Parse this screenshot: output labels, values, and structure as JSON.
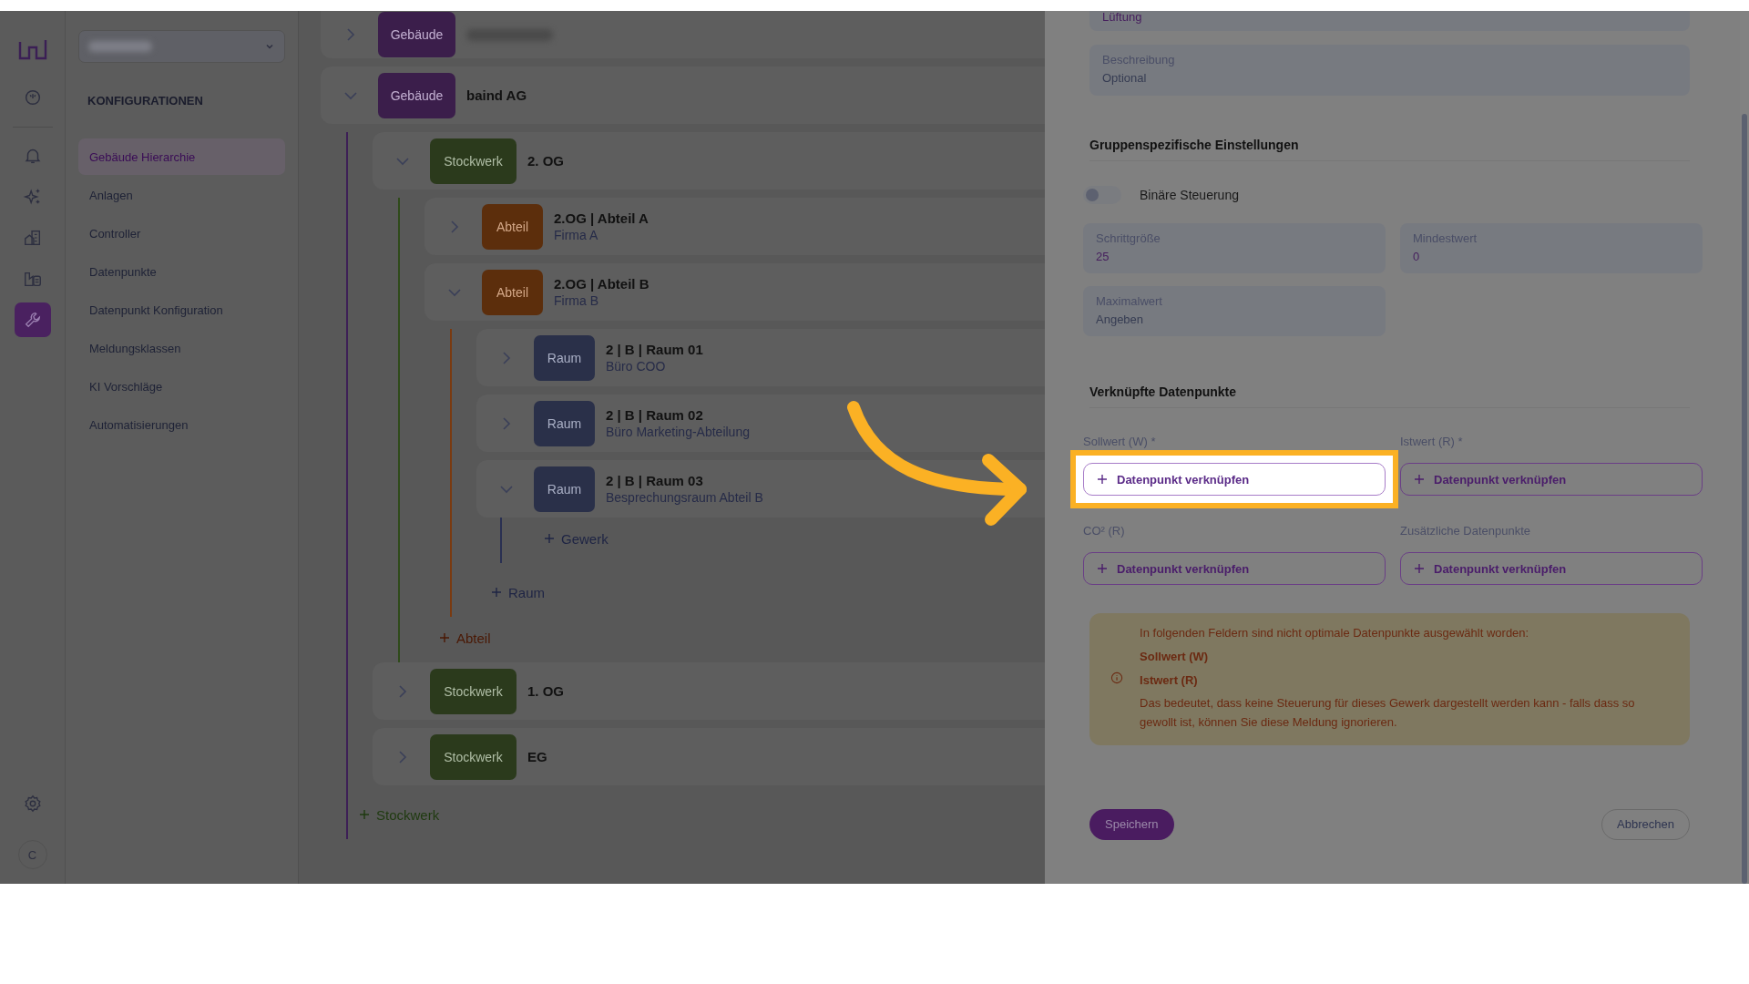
{
  "rail": {
    "items": [
      {
        "kind": "gauge",
        "selected": false
      },
      {
        "kind": "bell",
        "selected": false
      },
      {
        "kind": "sparkle",
        "selected": false
      },
      {
        "kind": "buildings",
        "selected": false
      },
      {
        "kind": "factory",
        "selected": false
      },
      {
        "kind": "wrench",
        "selected": true
      }
    ],
    "footer": [
      {
        "kind": "gear",
        "selected": false
      }
    ],
    "avatar": "C"
  },
  "nav": {
    "title": "KONFIGURATIONEN",
    "items": [
      {
        "label": "Gebäude Hierarchie",
        "selected": true
      },
      {
        "label": "Anlagen",
        "selected": false
      },
      {
        "label": "Controller",
        "selected": false
      },
      {
        "label": "Datenpunkte",
        "selected": false
      },
      {
        "label": "Datenpunkt Konfiguration",
        "selected": false
      },
      {
        "label": "Meldungsklassen",
        "selected": false
      },
      {
        "label": "KI Vorschläge",
        "selected": false
      },
      {
        "label": "Automatisierungen",
        "selected": false
      }
    ]
  },
  "tree": {
    "nodes": [
      {
        "kind": "building",
        "badge": "Gebäude",
        "expanded": false
      },
      {
        "kind": "building",
        "badge": "Gebäude",
        "title": "baind AG",
        "expanded": true,
        "add": {
          "kind": "floor",
          "label": "Stockwerk"
        },
        "children": [
          {
            "kind": "floor",
            "badge": "Stockwerk",
            "title": "2. OG",
            "expanded": true,
            "add": {
              "kind": "section",
              "label": "Abteil"
            },
            "children": [
              {
                "kind": "section",
                "badge": "Abteil",
                "title": "2.OG | Abteil A",
                "subtitle": "Firma A",
                "expanded": false
              },
              {
                "kind": "section",
                "badge": "Abteil",
                "title": "2.OG | Abteil B",
                "subtitle": "Firma B",
                "expanded": true,
                "add": {
                  "kind": "room",
                  "label": "Raum"
                },
                "children": [
                  {
                    "kind": "room",
                    "badge": "Raum",
                    "title": "2 | B | Raum 01",
                    "subtitle": "Büro COO",
                    "expanded": false
                  },
                  {
                    "kind": "room",
                    "badge": "Raum",
                    "title": "2 | B | Raum 02",
                    "subtitle": "Büro Marketing-Abteilung",
                    "expanded": false
                  },
                  {
                    "kind": "room",
                    "badge": "Raum",
                    "title": "2 | B | Raum 03",
                    "subtitle": "Besprechungsraum Abteil B",
                    "expanded": true,
                    "add": {
                      "kind": "room",
                      "label": "Gewerk"
                    }
                  }
                ]
              }
            ]
          },
          {
            "kind": "floor",
            "badge": "Stockwerk",
            "title": "1. OG",
            "expanded": false
          },
          {
            "kind": "floor",
            "badge": "Stockwerk",
            "title": "EG",
            "expanded": false
          }
        ]
      }
    ]
  },
  "drawer": {
    "top_field": {
      "value": "Lüftung"
    },
    "description": {
      "label": "Beschreibung",
      "placeholder": "Optional"
    },
    "group_heading": "Gruppenspezifische Einstellungen",
    "toggle": {
      "label": "Binäre Steuerung",
      "on": false
    },
    "fields": [
      {
        "label": "Schrittgröße",
        "value": "25"
      },
      {
        "label": "Mindestwert",
        "value": "0"
      },
      {
        "label": "Maximalwert",
        "placeholder": "Angeben"
      }
    ],
    "links_heading": "Verknüpfte Datenpunkte",
    "links": [
      {
        "label": "Sollwert (W) *",
        "button": "Datenpunkt verknüpfen",
        "highlighted": true
      },
      {
        "label": "Istwert (R) *",
        "button": "Datenpunkt verknüpfen",
        "highlighted": false
      },
      {
        "label": "CO² (R)",
        "button": "Datenpunkt verknüpfen",
        "highlighted": false
      },
      {
        "label": "Zusätzliche Datenpunkte",
        "button": "Datenpunkt verknüpfen",
        "highlighted": false
      }
    ],
    "warning": {
      "intro": "In folgenden Feldern sind nicht optimale Datenpunkte ausgewählt worden:",
      "items": [
        "Sollwert (W)",
        "Istwert (R)"
      ],
      "note": "Das bedeutet, dass keine Steuerung für dieses Gewerk dargestellt werden kann - falls dass so gewollt ist, können Sie diese Meldung ignorieren."
    },
    "save": "Speichern",
    "cancel": "Abbrechen"
  }
}
